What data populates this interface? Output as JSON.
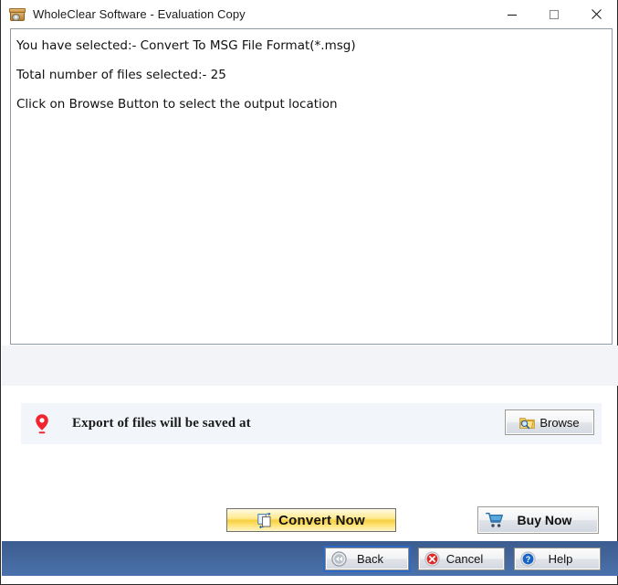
{
  "window": {
    "title": "WholeClear Software - Evaluation Copy",
    "icon": "app-archive-icon",
    "controls": {
      "minimize": "minimize-icon",
      "maximize": "maximize-icon",
      "close": "close-icon"
    }
  },
  "content": {
    "lines": [
      "You have selected:- Convert To MSG File Format(*.msg)",
      "Total number of files selected:- 25",
      "Click on Browse Button to select the output location"
    ],
    "selected_format": "Convert To MSG File Format(*.msg)",
    "total_files_selected": "25"
  },
  "export": {
    "label": "Export of files will be saved at",
    "path_value": "",
    "pin_icon": "location-pin-icon",
    "browse_label": "Browse",
    "browse_icon": "folder-search-icon"
  },
  "actions": {
    "convert_label": "Convert Now",
    "convert_icon": "convert-pages-icon",
    "buy_label": "Buy Now",
    "buy_icon": "shopping-cart-icon"
  },
  "footer": {
    "back_label": "Back",
    "back_icon": "rewind-circle-icon",
    "cancel_label": "Cancel",
    "cancel_icon": "cancel-circle-icon",
    "help_label": "Help",
    "help_icon": "help-circle-icon"
  },
  "colors": {
    "footer_bar_top": "#3a5c8f",
    "footer_bar_bottom": "#4a72ad",
    "convert_accent": "#f5cf3e",
    "pin_red": "#f0262f",
    "panel_bg": "#f2f5fa",
    "focus_ring": "#2d68c4"
  }
}
